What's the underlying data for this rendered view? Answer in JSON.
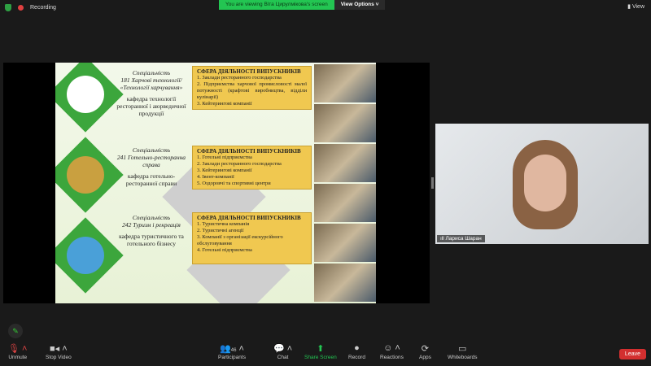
{
  "topbar": {
    "recording": "Recording",
    "viewing": "You are viewing Віта Цирулмікова's screen",
    "view_options": "View Options",
    "view": "View"
  },
  "slide": {
    "rows": [
      {
        "spec": "Спеціальність",
        "code": "181 Харчові технології/ «Технології харчування»",
        "dept": "кафедра технології ресторанної і аюрведичної продукції",
        "box_title": "СФЕРА ДІЯЛЬНОСТІ ВИПУСКНИКІВ",
        "items": [
          "1. Заклади ресторанного господарства",
          "2. Підприємства харчової промисловості малої потужності (крафтові виробництва, відділи кулінарії)",
          "3. Кейтерингові компанії"
        ]
      },
      {
        "spec": "Спеціальність",
        "code": "241 Готельно-ресторанна справа",
        "dept": "кафедра готельно-ресторанної справи",
        "box_title": "СФЕРА ДІЯЛЬНОСТІ ВИПУСКНИКІВ",
        "items": [
          "1. Готельні підприємства",
          "2. Заклади ресторанного господарства",
          "3. Кейтерингові компанії",
          "4. Івент-компанії",
          "5. Оздоровчі та спортивні центри"
        ]
      },
      {
        "spec": "Спеціальність",
        "code": "242 Туризм і рекреація",
        "dept": "кафедра туристичного та готельного бізнесу",
        "box_title": "СФЕРА ДІЯЛЬНОСТІ ВИПУСКНИКІВ",
        "items": [
          "1. Туристична компанія",
          "2. Туристичні агенції",
          "3. Компанії з організації екскурсійного обслуговування",
          "4. Готельні підприємства"
        ]
      }
    ]
  },
  "video": {
    "name": "Лариса Шаран"
  },
  "toolbar": {
    "unmute": "Unmute",
    "stop_video": "Stop Video",
    "participants": "Participants",
    "participants_count": "46",
    "chat": "Chat",
    "share": "Share Screen",
    "record": "Record",
    "reactions": "Reactions",
    "apps": "Apps",
    "whiteboards": "Whiteboards",
    "leave": "Leave"
  }
}
